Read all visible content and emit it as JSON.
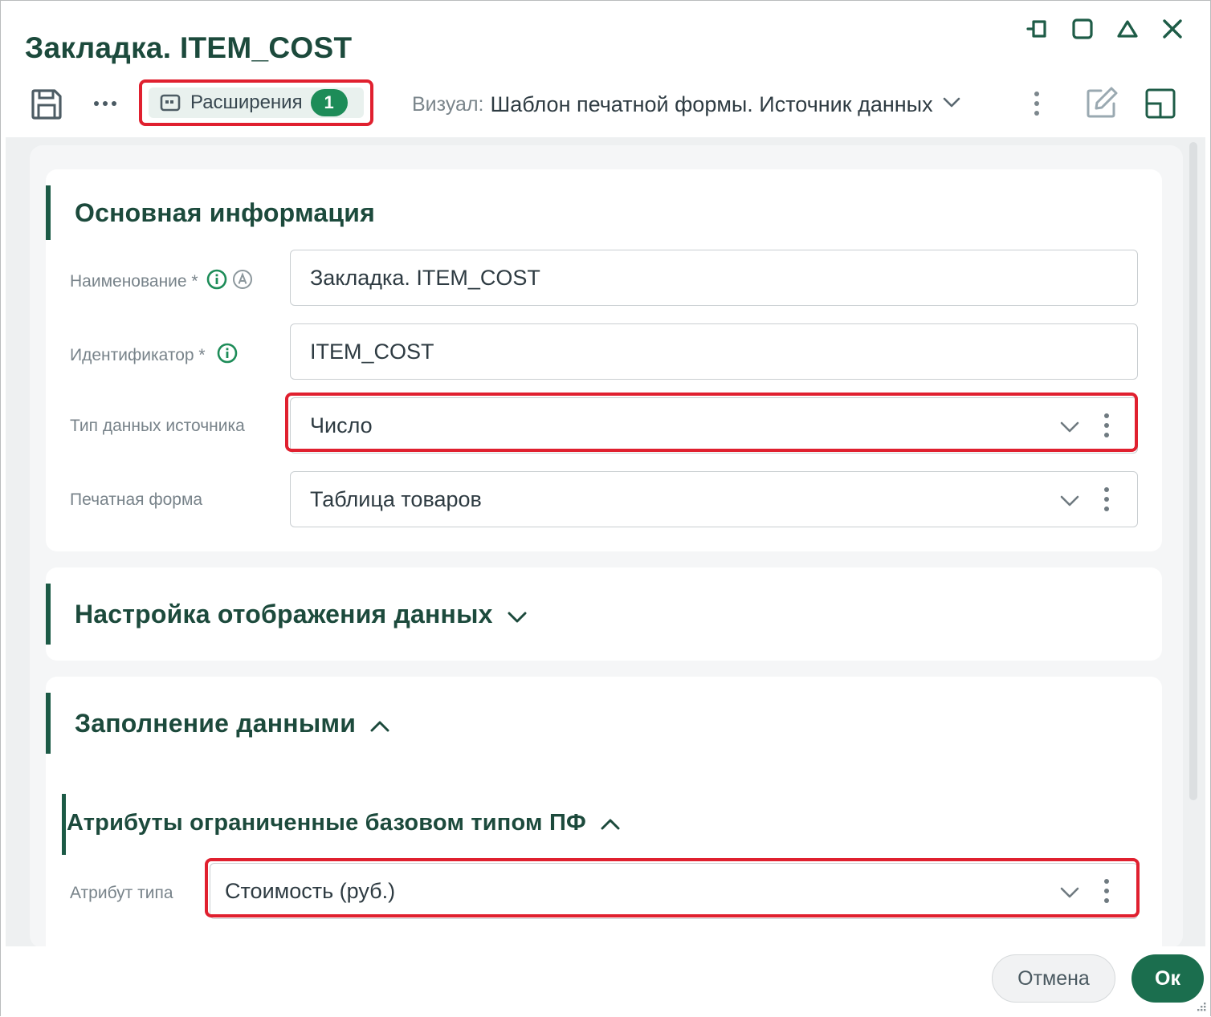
{
  "window": {
    "title": "Закладка. ITEM_COST",
    "controls": [
      "pin-icon",
      "maximize-icon",
      "collapse-icon",
      "close-icon"
    ]
  },
  "toolbar": {
    "save_icon": "save-icon",
    "more_icon": "more-horizontal-icon",
    "extensions_label": "Расширения",
    "extensions_count": "1",
    "visual_label": "Визуал:",
    "visual_value": "Шаблон печатной формы. Источник данных",
    "edit_icon": "edit-icon",
    "layout_icon": "layout-icon"
  },
  "sections": {
    "main_info": {
      "title": "Основная информация",
      "fields": {
        "name": {
          "label": "Наименование *",
          "value": "Закладка. ITEM_COST"
        },
        "identifier": {
          "label": "Идентификатор *",
          "value": "ITEM_COST"
        },
        "source_type": {
          "label": "Тип данных источника",
          "value": "Число"
        },
        "print_form": {
          "label": "Печатная форма",
          "value": "Таблица товаров"
        }
      }
    },
    "display_settings": {
      "title": "Настройка отображения данных"
    },
    "data_fill": {
      "title": "Заполнение данными",
      "subsection": {
        "title": "Атрибуты ограниченные базовом типом ПФ",
        "fields": {
          "type_attribute": {
            "label": "Атрибут типа",
            "value": "Стоимость (руб.)"
          }
        }
      }
    }
  },
  "footer": {
    "cancel_label": "Отмена",
    "ok_label": "Ок"
  },
  "colors": {
    "accent": "#1b6e4e",
    "title_text": "#1c4a3c",
    "badge": "#1d8c58",
    "highlight": "#e0202f"
  }
}
